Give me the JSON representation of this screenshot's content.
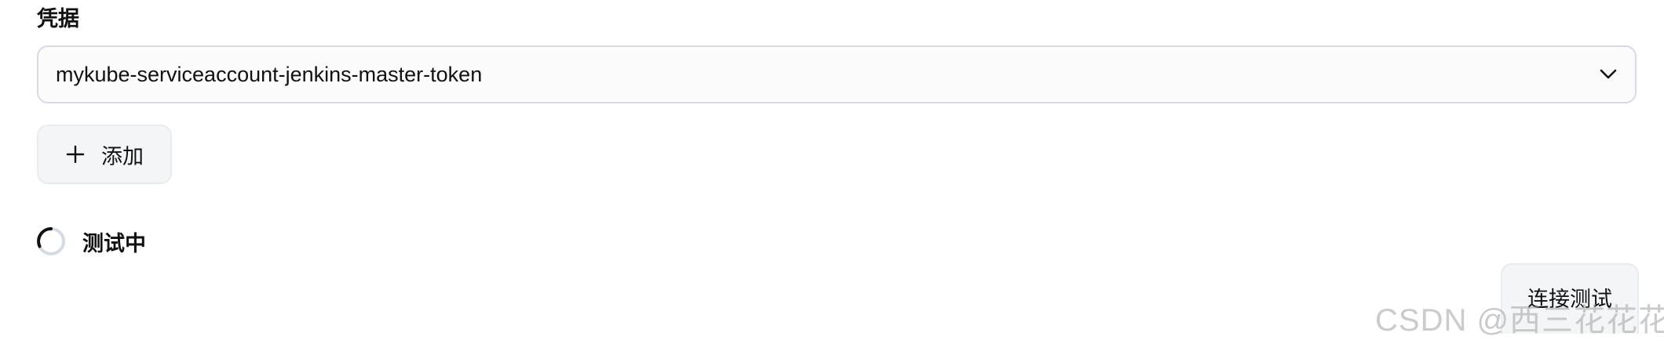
{
  "credentials": {
    "label": "凭据",
    "selected_value": "mykube-serviceaccount-jenkins-master-token",
    "dropdown_icon": "chevron-down-icon"
  },
  "add_button": {
    "icon": "plus-icon",
    "label": "添加"
  },
  "status": {
    "icon": "spinner-icon",
    "text": "测试中"
  },
  "test_connection_button": {
    "label": "连接测试"
  },
  "watermark": {
    "text": "CSDN @西三花花花"
  },
  "colors": {
    "border": "#d5dbe4",
    "button_bg": "#f3f5f7",
    "spinner_track": "#d5dbe4",
    "spinner_arc": "#111111"
  }
}
